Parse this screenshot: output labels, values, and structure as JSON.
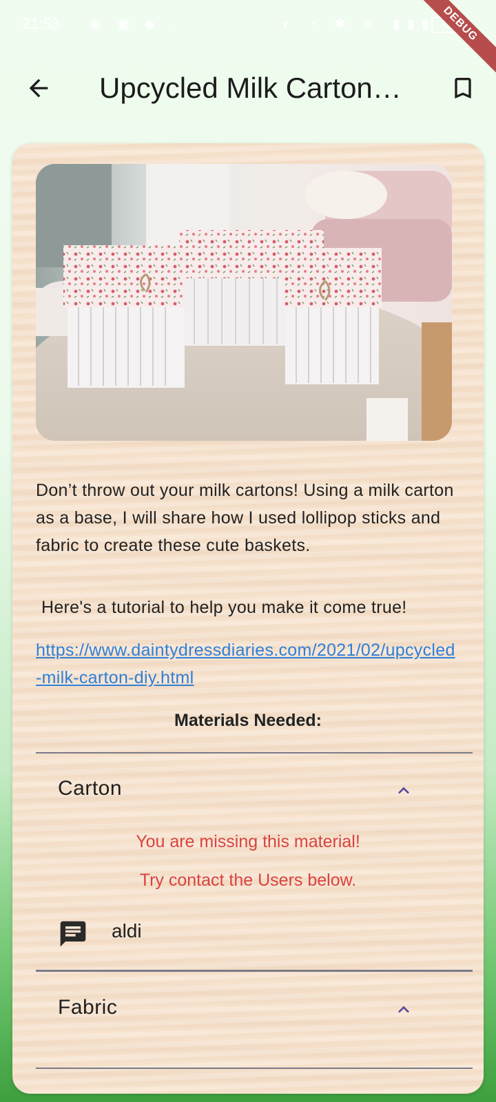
{
  "status_bar": {
    "time": "21:53",
    "battery": "53",
    "debug_label": "DEBUG"
  },
  "app_bar": {
    "title": "Upcycled Milk Carton Basket",
    "back_icon": "arrow-back-icon",
    "bookmark_icon": "bookmark-outline-icon"
  },
  "content": {
    "image_alt": "White popsicle-stick baskets lined with pink floral fabric on a round wooden table",
    "description": "Don’t throw out your milk cartons! Using a milk carton as a base, I will share how I used lollipop sticks and fabric to create these cute baskets.",
    "tutorial_intro": "Here's a tutorial to help you make it come true!",
    "tutorial_link": "https://www.daintydressdiaries.com/2021/02/upcycled-milk-carton-diy.html",
    "materials_heading": "Materials Needed:",
    "materials": [
      {
        "name": "Carton",
        "expanded": true,
        "missing_line1": "You are missing this material!",
        "missing_line2": "Try contact the Users below.",
        "users": [
          "aldi"
        ]
      },
      {
        "name": "Fabric",
        "expanded": true
      }
    ]
  },
  "colors": {
    "accent": "#5c4a9c",
    "warning": "#d9433f",
    "link": "#2f7fd8"
  }
}
